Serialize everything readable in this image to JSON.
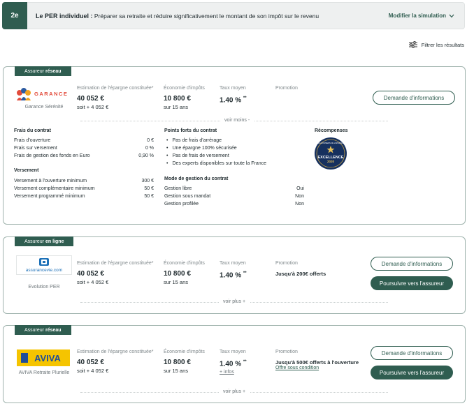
{
  "banner": {
    "step": "2e",
    "title_bold": "Le PER individuel :",
    "title_rest": " Préparer sa retraite et réduire significativement le montant de son impôt sur le revenu",
    "modify_label": "Modifier la simulation"
  },
  "filter": {
    "label": "Filtrer les résultats"
  },
  "labels": {
    "savings": "Estimation de l'épargne constituée*",
    "tax": "Économie d'impôts",
    "rate": "Taux moyen",
    "promo": "Promotion",
    "request_btn": "Demande d'informations",
    "continue_btn": "Poursuivre vers l'assureur",
    "see_less": "voir moins -",
    "see_more": "voir plus +"
  },
  "offers": [
    {
      "tag_prefix": "Assureur",
      "tag_type": "réseau",
      "logo_text": "GARANCE",
      "product": "Garance Sérénité",
      "savings": "40 052 €",
      "savings_sub": "soit + 4 052 €",
      "tax": "10 800 €",
      "tax_sub": "sur 15 ans",
      "rate": "1.40 %",
      "rate_mark": "**",
      "promo": "",
      "details": {
        "fees_title": "Frais du contrat",
        "fees": [
          {
            "label": "Frais d'ouverture",
            "value": "0 €"
          },
          {
            "label": "Frais sur versement",
            "value": "0 %"
          },
          {
            "label": "Frais de gestion des fonds en Euro",
            "value": "0,90 %"
          }
        ],
        "payment_title": "Versement",
        "payments": [
          {
            "label": "Versement à l'ouverture minimum",
            "value": "300 €"
          },
          {
            "label": "Versement complémentaire minimum",
            "value": "50 €"
          },
          {
            "label": "Versement programmé minimum",
            "value": "50 €"
          }
        ],
        "strengths_title": "Points forts du contrat",
        "strengths": [
          "Pas de frais d'arrérage",
          "Une épargne 100% sécurisée",
          "Pas de frais de versement",
          "Des experts disponibles sur toute la France"
        ],
        "management_title": "Mode de gestion du contrat",
        "management": [
          {
            "label": "Gestion libre",
            "value": "Oui"
          },
          {
            "label": "Gestion sous mandat",
            "value": "Non"
          },
          {
            "label": "Gestion profilée",
            "value": "Non"
          }
        ],
        "awards_title": "Récompenses",
        "award_top": "LES DOSSIERS DE L'ÉPARGNE",
        "award_main": "EXCELLENCE",
        "award_year": "2020"
      }
    },
    {
      "tag_prefix": "Assureur",
      "tag_type": "en ligne",
      "logo_text": "assurancevie.com",
      "product": "Evolution PER",
      "savings": "40 052 €",
      "savings_sub": "soit + 4 052 €",
      "tax": "10 800 €",
      "tax_sub": "sur 15 ans",
      "rate": "1.40 %",
      "rate_mark": "**",
      "promo": "Jusqu'à 200€ offerts"
    },
    {
      "tag_prefix": "Assureur",
      "tag_type": "réseau",
      "logo_text": "AVIVA",
      "product": "AVIVA Retraite Plurielle",
      "savings": "40 052 €",
      "savings_sub": "soit + 4 052 €",
      "tax": "10 800 €",
      "tax_sub": "sur 15 ans",
      "rate": "1.40 %",
      "rate_mark": "**",
      "rate_info": "+ infos",
      "promo": "Jusqu'à 500€ offerts à l'ouverture",
      "promo_link": "Offre sous condition"
    }
  ],
  "colors": {
    "brand": "#2f5d50",
    "aviva_yellow": "#f5c400"
  }
}
